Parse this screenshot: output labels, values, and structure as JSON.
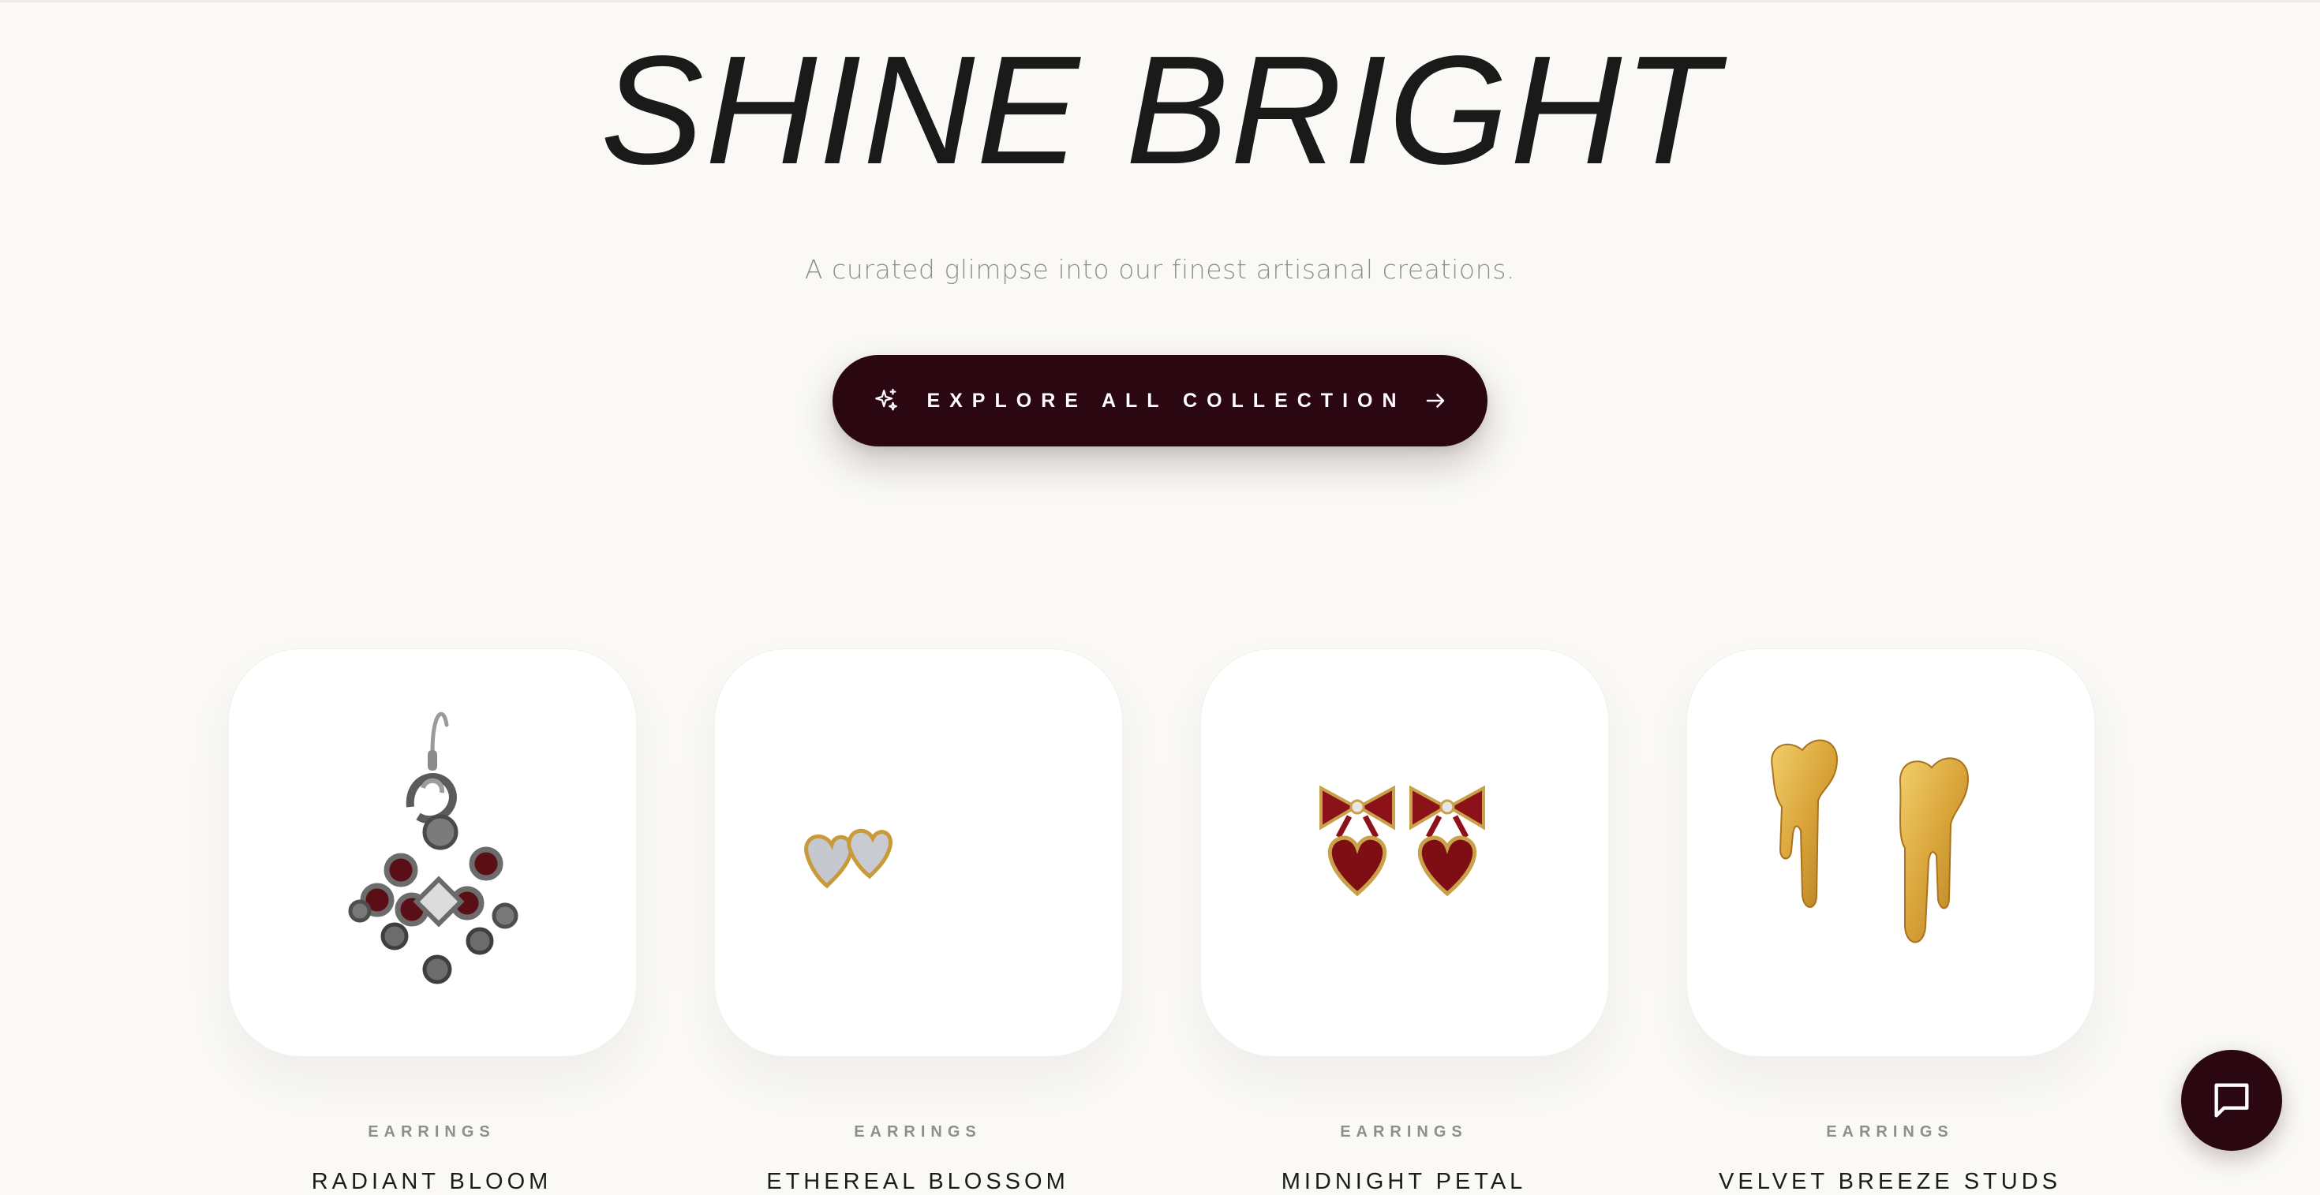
{
  "hero": {
    "title": "SHINE BRIGHT",
    "subtitle": "A curated glimpse into our finest artisanal creations."
  },
  "cta": {
    "label": "EXPLORE ALL COLLECTION",
    "icon": "sparkle-icon",
    "trailing_icon": "arrow-right-icon"
  },
  "products": [
    {
      "category": "EARRINGS",
      "name": "RADIANT BLOOM"
    },
    {
      "category": "EARRINGS",
      "name": "ETHEREAL BLOSSOM"
    },
    {
      "category": "EARRINGS",
      "name": "MIDNIGHT PETAL"
    },
    {
      "category": "EARRINGS",
      "name": "VELVET BREEZE STUDS"
    }
  ],
  "chat": {
    "icon": "chat-bubble-icon"
  },
  "colors": {
    "background": "#faf9f6",
    "accent": "#2b0711",
    "title": "#1a1a1a",
    "muted": "#8f8f8f"
  }
}
